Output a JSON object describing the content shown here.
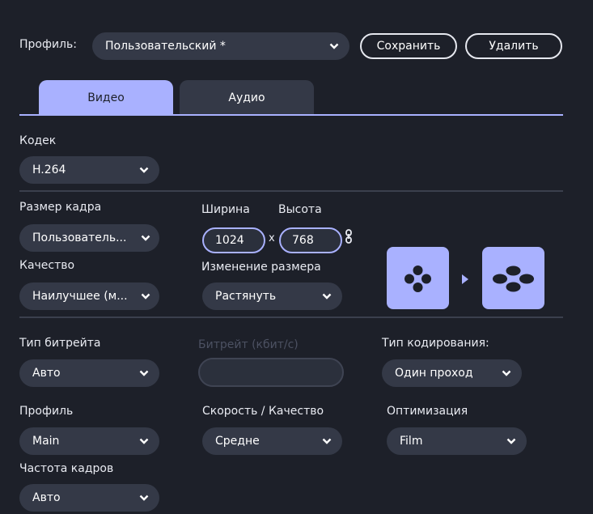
{
  "header": {
    "profile_label": "Профиль:",
    "profile_value": "Пользовательский *",
    "save_label": "Сохранить",
    "delete_label": "Удалить"
  },
  "tabs": [
    {
      "label": "Видео",
      "active": true
    },
    {
      "label": "Аудио",
      "active": false
    }
  ],
  "codec": {
    "label": "Кодек",
    "value": "H.264"
  },
  "frame_size": {
    "label": "Размер кадра",
    "value": "Пользователь..."
  },
  "width": {
    "label": "Ширина",
    "value": "1024"
  },
  "height": {
    "label": "Высота",
    "value": "768"
  },
  "times_symbol": "x",
  "quality": {
    "label": "Качество",
    "value": "Наилучшее (м..."
  },
  "resize": {
    "label": "Изменение размера",
    "value": "Растянуть"
  },
  "bitrate_type": {
    "label": "Тип битрейта",
    "value": "Авто"
  },
  "bitrate": {
    "label": "Битрейт (кбит/с)",
    "value": ""
  },
  "encoding_type": {
    "label": "Тип кодирования:",
    "value": "Один проход"
  },
  "profile": {
    "label": "Профиль",
    "value": "Main"
  },
  "speed_quality": {
    "label": "Скорость / Качество",
    "value": "Средне"
  },
  "optimization": {
    "label": "Оптимизация",
    "value": "Film"
  },
  "frame_rate": {
    "label": "Частота кадров",
    "value": "Авто"
  },
  "colors": {
    "background": "#1d2029",
    "accent": "#a9b1ff",
    "control": "#343947",
    "divider": "#3b404d"
  },
  "icons": [
    "chevron-down-icon",
    "link-icon",
    "resize-before-icon",
    "play-arrow-icon",
    "resize-after-icon"
  ]
}
